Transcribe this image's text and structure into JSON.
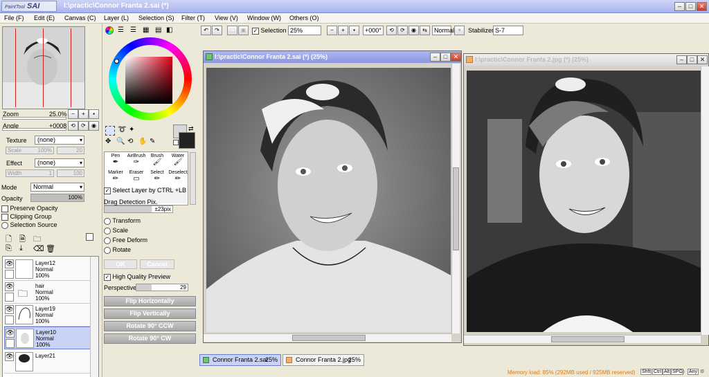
{
  "app": {
    "logo_top": "PaintTool",
    "logo_name": "SAI",
    "title": "I:\\practic\\Connor Franta 2.sai (*)"
  },
  "menu": [
    "File (F)",
    "Edit (E)",
    "Canvas (C)",
    "Layer (L)",
    "Selection (S)",
    "Filter (T)",
    "View (V)",
    "Window (W)",
    "Others (O)"
  ],
  "toolbar": {
    "selection_label": "Selection",
    "zoom_value": "25%",
    "angle_value": "+000°",
    "mode_value": "Normal",
    "stabilizer_label": "Stabilizer",
    "stabilizer_value": "S-7"
  },
  "navigator": {
    "zoom_label": "Zoom",
    "zoom_value": "25.0%",
    "angle_label": "Angle",
    "angle_value": "+0008"
  },
  "brush_settings": {
    "texture_label": "Texture",
    "texture_value": "(none)",
    "texture_scale_label": "Scale",
    "texture_scale_pct": "100%",
    "texture_scale_num": "20",
    "effect_label": "Effect",
    "effect_value": "(none)",
    "effect_width_label": "Width",
    "effect_width_num": "1",
    "effect_width_max": "100"
  },
  "layer_props": {
    "mode_label": "Mode",
    "mode_value": "Normal",
    "opacity_label": "Opacity",
    "opacity_value": "100%",
    "preserve_opacity": "Preserve Opacity",
    "clipping_group": "Clipping Group",
    "selection_source": "Selection Source"
  },
  "layers": [
    {
      "name": "Layer12",
      "mode": "Normal",
      "opacity": "100%"
    },
    {
      "name": "hair",
      "mode": "Normal",
      "opacity": "100%"
    },
    {
      "name": "Layer19",
      "mode": "Normal",
      "opacity": "100%"
    },
    {
      "name": "Layer10",
      "mode": "Normal",
      "opacity": "100%"
    },
    {
      "name": "Layer21",
      "mode": "",
      "opacity": ""
    }
  ],
  "tools": [
    "Pen",
    "AirBrush",
    "Brush",
    "Water",
    "Marker",
    "Eraser",
    "Select",
    "Deselect"
  ],
  "tool_options": {
    "select_layer": "Select Layer by CTRL +LB",
    "drag_detection_label": "Drag Detection Pix.",
    "drag_detection_value": "±23pix",
    "transform": "Transform",
    "scale": "Scale",
    "free_deform": "Free Deform",
    "rotate": "Rotate",
    "ok": "OK",
    "cancel": "Cancel",
    "hq_preview": "High Quality Preview",
    "perspective_label": "Perspective",
    "perspective_value": "29",
    "flip_h": "Flip Horizontally",
    "flip_v": "Flip Vertically",
    "rot_ccw": "Rotate 90° CCW",
    "rot_cw": "Rotate 90° CW"
  },
  "documents": [
    {
      "title": "I:\\practic\\Connor Franta 2.sai (*) (25%)"
    },
    {
      "title": "I:\\practic\\Connor Franta 2.jpg (*) (25%)"
    }
  ],
  "tabs": [
    {
      "name": "Connor Franta 2.sai",
      "zoom": "25%"
    },
    {
      "name": "Connor Franta 2.jpg",
      "zoom": "25%"
    }
  ],
  "status": {
    "memory": "Memory load: 85% (292MB used / 925MB reserved)",
    "keys": [
      "Shft",
      "Ctrl",
      "Alt",
      "SPC",
      "Any"
    ]
  },
  "colors": {
    "title_active": "#8c97e0",
    "memory_text": "#e07a10"
  }
}
